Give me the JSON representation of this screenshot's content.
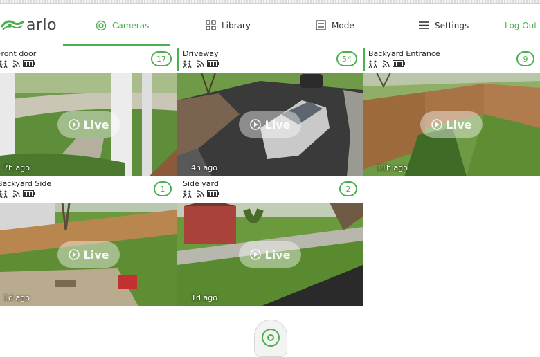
{
  "app": {
    "logo_text": "arlo"
  },
  "nav": {
    "cameras": "Cameras",
    "library": "Library",
    "mode": "Mode",
    "settings": "Settings",
    "logout": "Log Out"
  },
  "accent_color": "#4caf50",
  "cameras": [
    {
      "name": "Front door",
      "badge": "17",
      "ago": "7h ago",
      "live": "Live",
      "selected": false
    },
    {
      "name": "Driveway",
      "badge": "54",
      "ago": "4h ago",
      "live": "Live",
      "selected": true
    },
    {
      "name": "Backyard Entrance",
      "badge": "9",
      "ago": "11h ago",
      "live": "Live",
      "selected": true
    },
    {
      "name": "Backyard Side",
      "badge": "1",
      "ago": "1d ago",
      "live": "Live",
      "selected": false
    },
    {
      "name": "Side yard",
      "badge": "2",
      "ago": "1d ago",
      "live": "Live",
      "selected": false
    }
  ],
  "icons": [
    "motion-icon",
    "audio-icon",
    "wifi-icon",
    "battery-icon",
    "play-icon",
    "cameras-icon",
    "library-icon",
    "mode-icon",
    "settings-icon",
    "arlo-logo-icon",
    "hub-icon"
  ]
}
